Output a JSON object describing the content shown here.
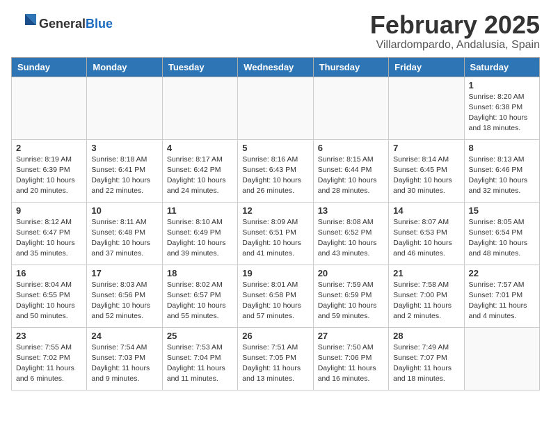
{
  "header": {
    "logo_general": "General",
    "logo_blue": "Blue",
    "month": "February 2025",
    "location": "Villardompardo, Andalusia, Spain"
  },
  "weekdays": [
    "Sunday",
    "Monday",
    "Tuesday",
    "Wednesday",
    "Thursday",
    "Friday",
    "Saturday"
  ],
  "weeks": [
    [
      {
        "day": "",
        "info": ""
      },
      {
        "day": "",
        "info": ""
      },
      {
        "day": "",
        "info": ""
      },
      {
        "day": "",
        "info": ""
      },
      {
        "day": "",
        "info": ""
      },
      {
        "day": "",
        "info": ""
      },
      {
        "day": "1",
        "info": "Sunrise: 8:20 AM\nSunset: 6:38 PM\nDaylight: 10 hours\nand 18 minutes."
      }
    ],
    [
      {
        "day": "2",
        "info": "Sunrise: 8:19 AM\nSunset: 6:39 PM\nDaylight: 10 hours\nand 20 minutes."
      },
      {
        "day": "3",
        "info": "Sunrise: 8:18 AM\nSunset: 6:41 PM\nDaylight: 10 hours\nand 22 minutes."
      },
      {
        "day": "4",
        "info": "Sunrise: 8:17 AM\nSunset: 6:42 PM\nDaylight: 10 hours\nand 24 minutes."
      },
      {
        "day": "5",
        "info": "Sunrise: 8:16 AM\nSunset: 6:43 PM\nDaylight: 10 hours\nand 26 minutes."
      },
      {
        "day": "6",
        "info": "Sunrise: 8:15 AM\nSunset: 6:44 PM\nDaylight: 10 hours\nand 28 minutes."
      },
      {
        "day": "7",
        "info": "Sunrise: 8:14 AM\nSunset: 6:45 PM\nDaylight: 10 hours\nand 30 minutes."
      },
      {
        "day": "8",
        "info": "Sunrise: 8:13 AM\nSunset: 6:46 PM\nDaylight: 10 hours\nand 32 minutes."
      }
    ],
    [
      {
        "day": "9",
        "info": "Sunrise: 8:12 AM\nSunset: 6:47 PM\nDaylight: 10 hours\nand 35 minutes."
      },
      {
        "day": "10",
        "info": "Sunrise: 8:11 AM\nSunset: 6:48 PM\nDaylight: 10 hours\nand 37 minutes."
      },
      {
        "day": "11",
        "info": "Sunrise: 8:10 AM\nSunset: 6:49 PM\nDaylight: 10 hours\nand 39 minutes."
      },
      {
        "day": "12",
        "info": "Sunrise: 8:09 AM\nSunset: 6:51 PM\nDaylight: 10 hours\nand 41 minutes."
      },
      {
        "day": "13",
        "info": "Sunrise: 8:08 AM\nSunset: 6:52 PM\nDaylight: 10 hours\nand 43 minutes."
      },
      {
        "day": "14",
        "info": "Sunrise: 8:07 AM\nSunset: 6:53 PM\nDaylight: 10 hours\nand 46 minutes."
      },
      {
        "day": "15",
        "info": "Sunrise: 8:05 AM\nSunset: 6:54 PM\nDaylight: 10 hours\nand 48 minutes."
      }
    ],
    [
      {
        "day": "16",
        "info": "Sunrise: 8:04 AM\nSunset: 6:55 PM\nDaylight: 10 hours\nand 50 minutes."
      },
      {
        "day": "17",
        "info": "Sunrise: 8:03 AM\nSunset: 6:56 PM\nDaylight: 10 hours\nand 52 minutes."
      },
      {
        "day": "18",
        "info": "Sunrise: 8:02 AM\nSunset: 6:57 PM\nDaylight: 10 hours\nand 55 minutes."
      },
      {
        "day": "19",
        "info": "Sunrise: 8:01 AM\nSunset: 6:58 PM\nDaylight: 10 hours\nand 57 minutes."
      },
      {
        "day": "20",
        "info": "Sunrise: 7:59 AM\nSunset: 6:59 PM\nDaylight: 10 hours\nand 59 minutes."
      },
      {
        "day": "21",
        "info": "Sunrise: 7:58 AM\nSunset: 7:00 PM\nDaylight: 11 hours\nand 2 minutes."
      },
      {
        "day": "22",
        "info": "Sunrise: 7:57 AM\nSunset: 7:01 PM\nDaylight: 11 hours\nand 4 minutes."
      }
    ],
    [
      {
        "day": "23",
        "info": "Sunrise: 7:55 AM\nSunset: 7:02 PM\nDaylight: 11 hours\nand 6 minutes."
      },
      {
        "day": "24",
        "info": "Sunrise: 7:54 AM\nSunset: 7:03 PM\nDaylight: 11 hours\nand 9 minutes."
      },
      {
        "day": "25",
        "info": "Sunrise: 7:53 AM\nSunset: 7:04 PM\nDaylight: 11 hours\nand 11 minutes."
      },
      {
        "day": "26",
        "info": "Sunrise: 7:51 AM\nSunset: 7:05 PM\nDaylight: 11 hours\nand 13 minutes."
      },
      {
        "day": "27",
        "info": "Sunrise: 7:50 AM\nSunset: 7:06 PM\nDaylight: 11 hours\nand 16 minutes."
      },
      {
        "day": "28",
        "info": "Sunrise: 7:49 AM\nSunset: 7:07 PM\nDaylight: 11 hours\nand 18 minutes."
      },
      {
        "day": "",
        "info": ""
      }
    ]
  ]
}
